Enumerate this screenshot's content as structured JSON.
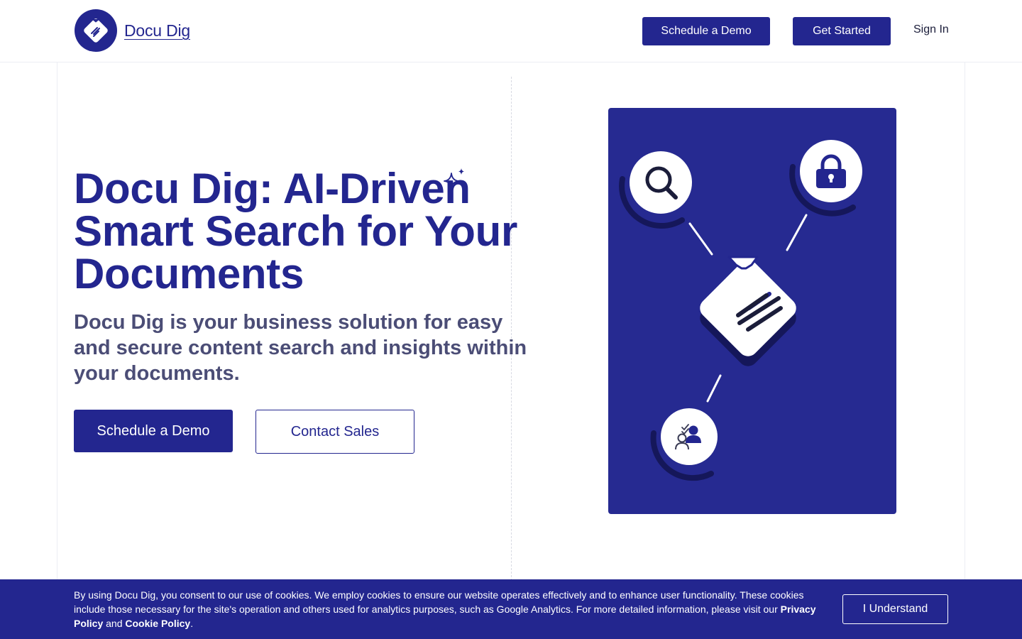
{
  "header": {
    "logo_text": "Docu Dig",
    "schedule_demo_label": "Schedule a Demo",
    "get_started_label": "Get Started",
    "sign_in_label": "Sign In"
  },
  "hero": {
    "title": "Docu Dig: AI-Driven Smart Search for Your Documents",
    "subtitle": "Docu Dig is your business solution for easy and secure content search and insights within your documents.",
    "primary_button": "Schedule a Demo",
    "secondary_button": "Contact Sales"
  },
  "illustration": {
    "icons": [
      "search-icon",
      "lock-icon",
      "document-icon",
      "users-check-icon"
    ]
  },
  "cookie_banner": {
    "text_before": "By using Docu Dig, you consent to our use of cookies. We employ cookies to ensure our website operates effectively and to enhance user functionality. These cookies include those necessary for the site's operation and others used for analytics purposes, such as Google Analytics. For more detailed information, please visit our ",
    "privacy_link": "Privacy Policy",
    "and_text": " and ",
    "cookie_link": "Cookie Policy",
    "period": ".",
    "accept_label": "I Understand"
  },
  "colors": {
    "brand": "#23268f",
    "text_muted": "#4b4d76",
    "white": "#ffffff"
  }
}
